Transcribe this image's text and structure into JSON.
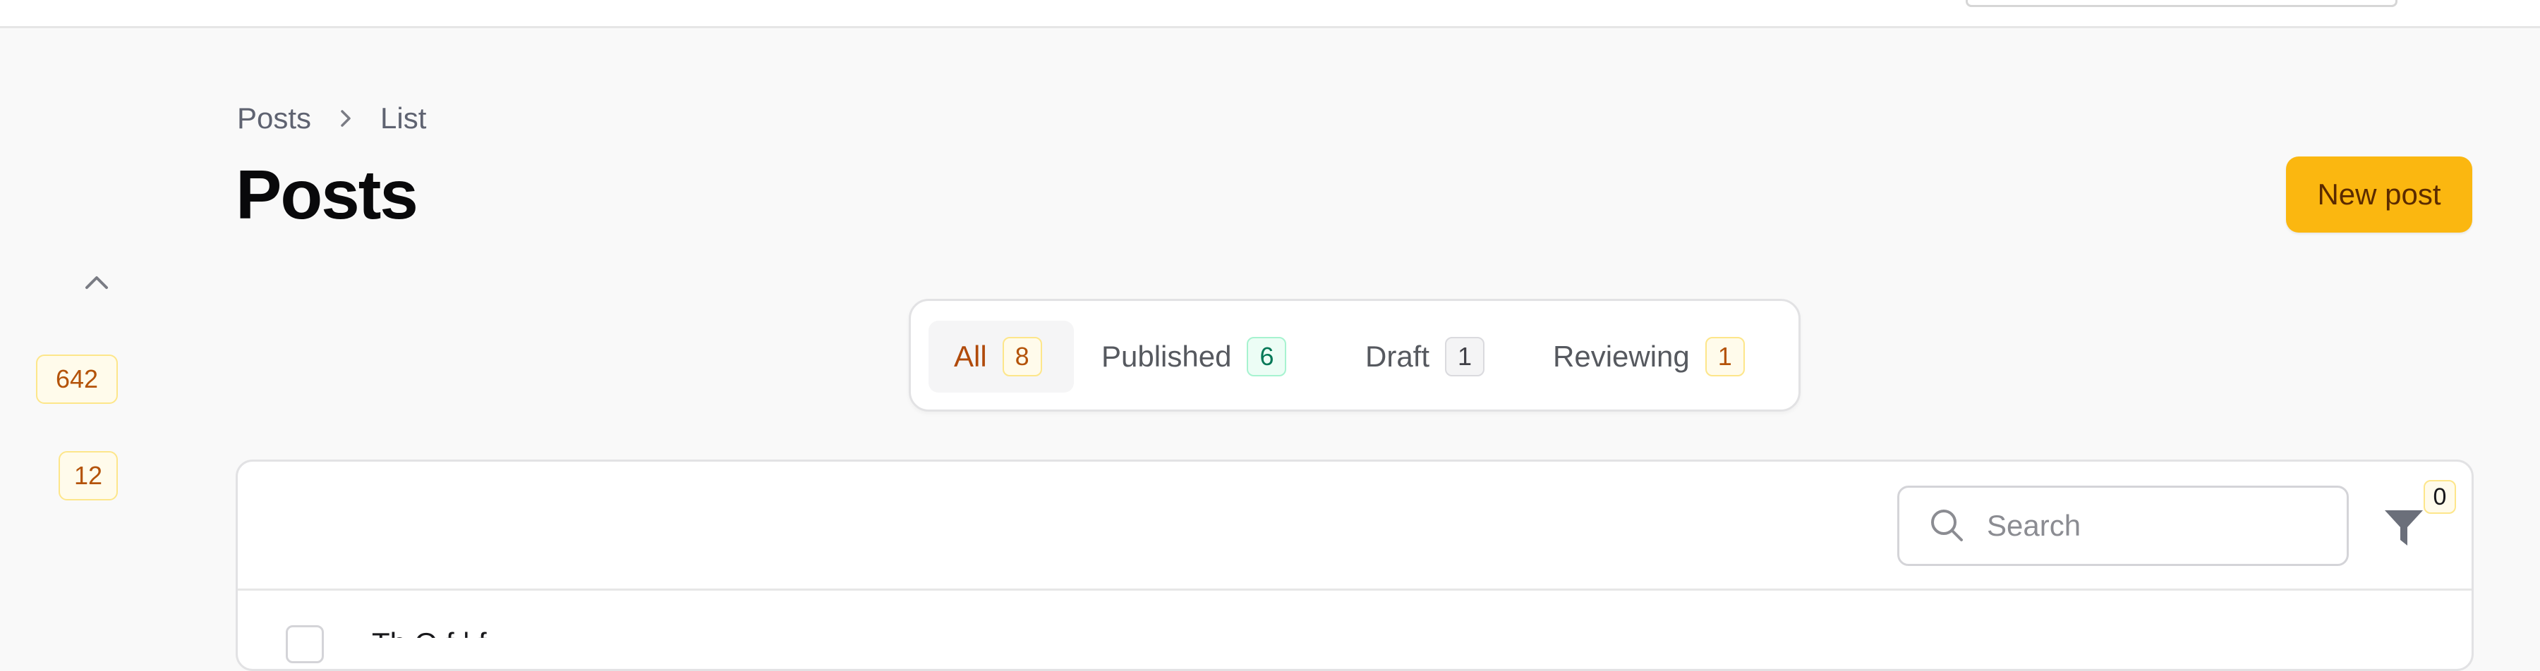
{
  "breadcrumb": {
    "items": [
      "Posts",
      "List"
    ]
  },
  "page": {
    "title": "Posts"
  },
  "header": {
    "new_post_label": "New post"
  },
  "rail": {
    "badges": [
      "642",
      "12"
    ]
  },
  "tabs": [
    {
      "label": "All",
      "count": "8",
      "active": true
    },
    {
      "label": "Published",
      "count": "6",
      "active": false
    },
    {
      "label": "Draft",
      "count": "1",
      "active": false
    },
    {
      "label": "Reviewing",
      "count": "1",
      "active": false
    }
  ],
  "search": {
    "placeholder": "Search",
    "value": ""
  },
  "filters": {
    "active_count": "0"
  },
  "table": {
    "rows": [
      {
        "title": "Th                                        O                                            f                              |                                      f                     "
      }
    ]
  },
  "colors": {
    "accent": "#fbb710",
    "active_tab_text": "#b04a0b",
    "amber_badge_bg": "#fffbeb",
    "green_badge_bg": "#ecfdf5"
  },
  "icons": {
    "breadcrumb_separator": "chevron-right-icon",
    "rail_toggle": "chevron-up-icon",
    "search": "search-icon",
    "filter": "funnel-icon"
  }
}
